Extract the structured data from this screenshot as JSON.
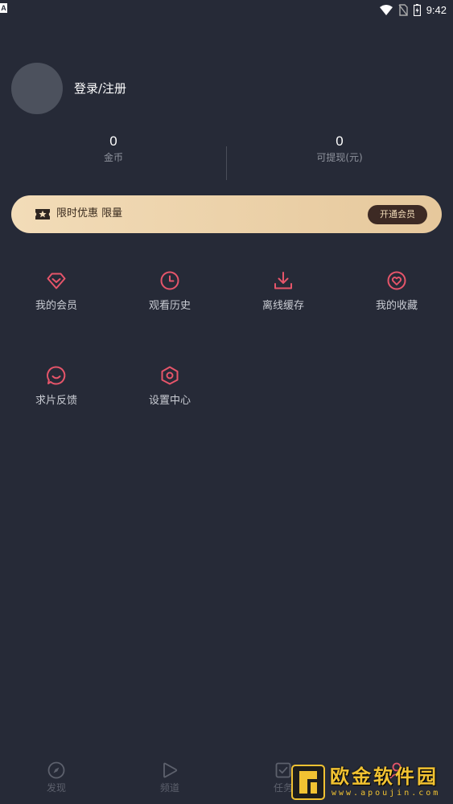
{
  "status_bar": {
    "notification_letter": "A",
    "time": "9:42"
  },
  "profile": {
    "login_label": "登录/注册"
  },
  "stats": [
    {
      "value": "0",
      "label": "金币"
    },
    {
      "value": "0",
      "label": "可提现(元)"
    }
  ],
  "vip_banner": {
    "text": "限时优惠 限量",
    "button_label": "开通会员"
  },
  "menu": [
    {
      "label": "我的会员",
      "icon": "diamond-icon"
    },
    {
      "label": "观看历史",
      "icon": "clock-icon"
    },
    {
      "label": "离线缓存",
      "icon": "download-icon"
    },
    {
      "label": "我的收藏",
      "icon": "heart-icon"
    },
    {
      "label": "求片反馈",
      "icon": "chat-smile-icon"
    },
    {
      "label": "设置中心",
      "icon": "settings-hex-icon"
    }
  ],
  "bottom_nav": [
    {
      "label": "发现",
      "icon": "compass-icon"
    },
    {
      "label": "频道",
      "icon": "play-icon"
    },
    {
      "label": "任务",
      "icon": "task-icon"
    },
    {
      "label": "",
      "icon": "person-icon"
    }
  ],
  "watermark": {
    "text": "欧金软件园",
    "url": "www.apoujin.com"
  },
  "colors": {
    "background": "#262a37",
    "accent": "#e6556a",
    "vip_gold": "#e6c89c",
    "vip_button": "#3d2a24"
  }
}
